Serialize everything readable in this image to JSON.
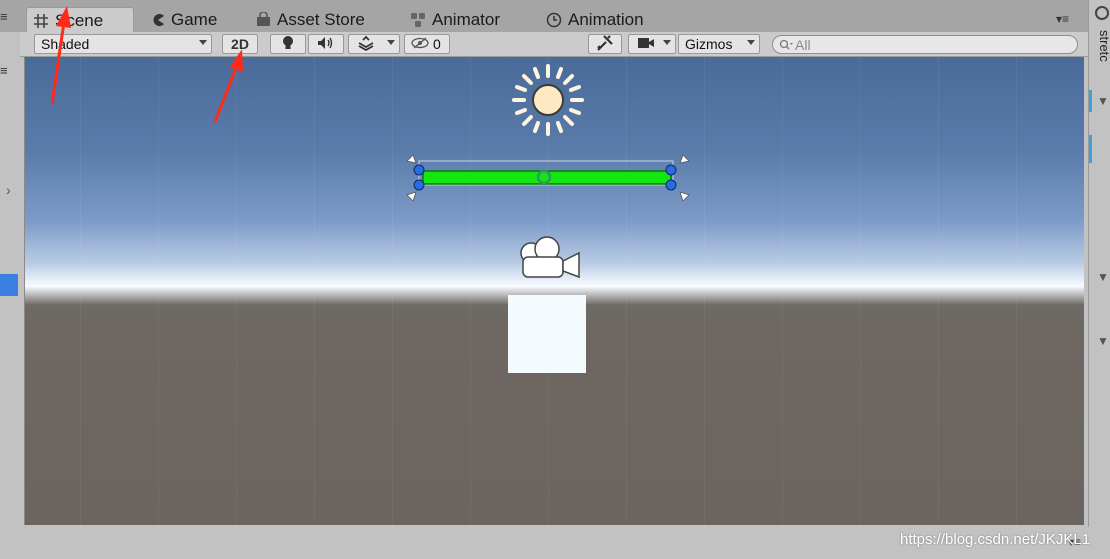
{
  "tabs": [
    {
      "label": "Scene",
      "icon": "grid-icon",
      "active": true
    },
    {
      "label": "Game",
      "icon": "pacman-icon",
      "active": false
    },
    {
      "label": "Asset Store",
      "icon": "bag-icon",
      "active": false
    },
    {
      "label": "Animator",
      "icon": "animator-icon",
      "active": false
    },
    {
      "label": "Animation",
      "icon": "clock-icon",
      "active": false
    }
  ],
  "toolbar": {
    "shading_mode": "Shaded",
    "mode_2d": "2D",
    "hidden_count": "0",
    "gizmos_label": "Gizmos",
    "search_placeholder": "All"
  },
  "right_panel": {
    "label": "stretc"
  },
  "watermark": "https://blog.csdn.net/JKJKL1",
  "colors": {
    "accent_green": "#14e614",
    "handle_blue": "#2b6be0",
    "annotation_red": "#ff2a1a",
    "selection_blue": "#3b7fe0"
  }
}
